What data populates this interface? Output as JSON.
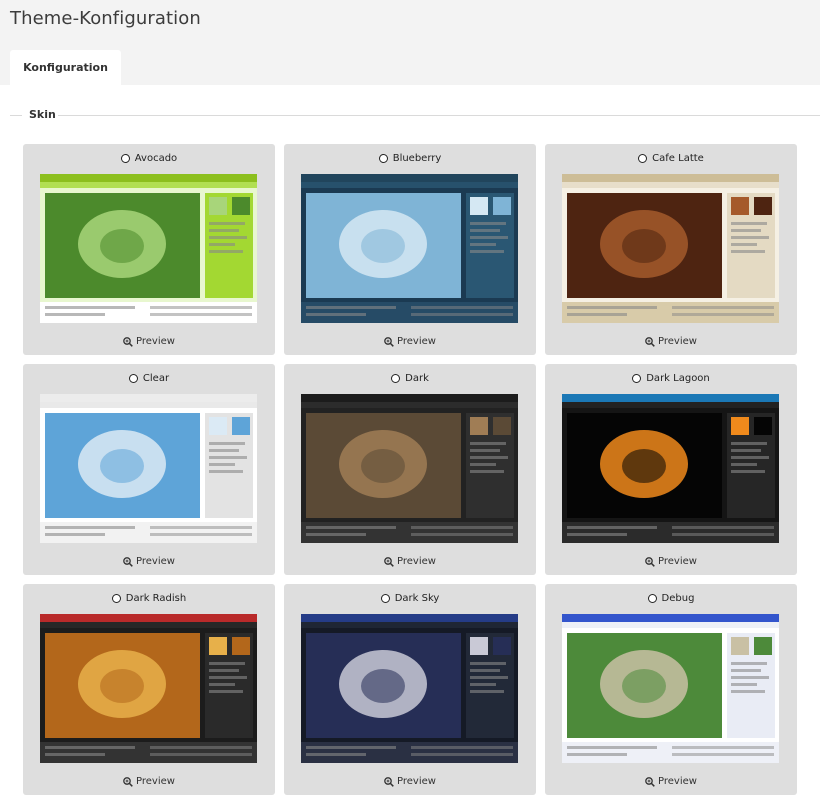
{
  "page": {
    "title": "Theme-Konfiguration"
  },
  "tabs": [
    {
      "label": "Konfiguration"
    }
  ],
  "section": {
    "legend": "Skin"
  },
  "preview_label": "Preview",
  "skins": [
    {
      "name": "Avocado",
      "top": "#8cbf1e",
      "bg": "#e8f7cf",
      "side": "#a3d832",
      "img": "#4c8a2c",
      "img2": "#a8d57a",
      "foot": "#fff"
    },
    {
      "name": "Blueberry",
      "top": "#21455c",
      "bg": "#1b3a52",
      "side": "#2a5773",
      "img": "#7fb4d6",
      "img2": "#d5e8f3",
      "foot": "#264b66"
    },
    {
      "name": "Cafe Latte",
      "top": "#cdbd97",
      "bg": "#f5f0e4",
      "side": "#e4dac3",
      "img": "#4e2411",
      "img2": "#a55a2b",
      "foot": "#d8cba9"
    },
    {
      "name": "Clear",
      "top": "#ececec",
      "bg": "#ffffff",
      "side": "#e3e3e3",
      "img": "#5ea4d8",
      "img2": "#dbeaf5",
      "foot": "#f2f2f2"
    },
    {
      "name": "Dark",
      "top": "#1c1c1c",
      "bg": "#222222",
      "side": "#2f2f2f",
      "img": "#5b4a36",
      "img2": "#a07d55",
      "foot": "#333"
    },
    {
      "name": "Dark Lagoon",
      "top": "#1b78b6",
      "bg": "#151515",
      "side": "#262626",
      "img": "#050505",
      "img2": "#f08a1c",
      "foot": "#2b2b2b"
    },
    {
      "name": "Dark Radish",
      "top": "#b92a2a",
      "bg": "#1c1c1c",
      "side": "#2a2a2a",
      "img": "#b3671b",
      "img2": "#e7b04a",
      "foot": "#333"
    },
    {
      "name": "Dark Sky",
      "top": "#253c87",
      "bg": "#151a26",
      "side": "#222938",
      "img": "#262e56",
      "img2": "#c9c9d6",
      "foot": "#2a3043"
    },
    {
      "name": "Debug",
      "top": "#3355cc",
      "bg": "#ffffff",
      "side": "#e9ecf5",
      "img": "#4d8a3a",
      "img2": "#c9c0a4",
      "foot": "#eef0f7"
    }
  ]
}
